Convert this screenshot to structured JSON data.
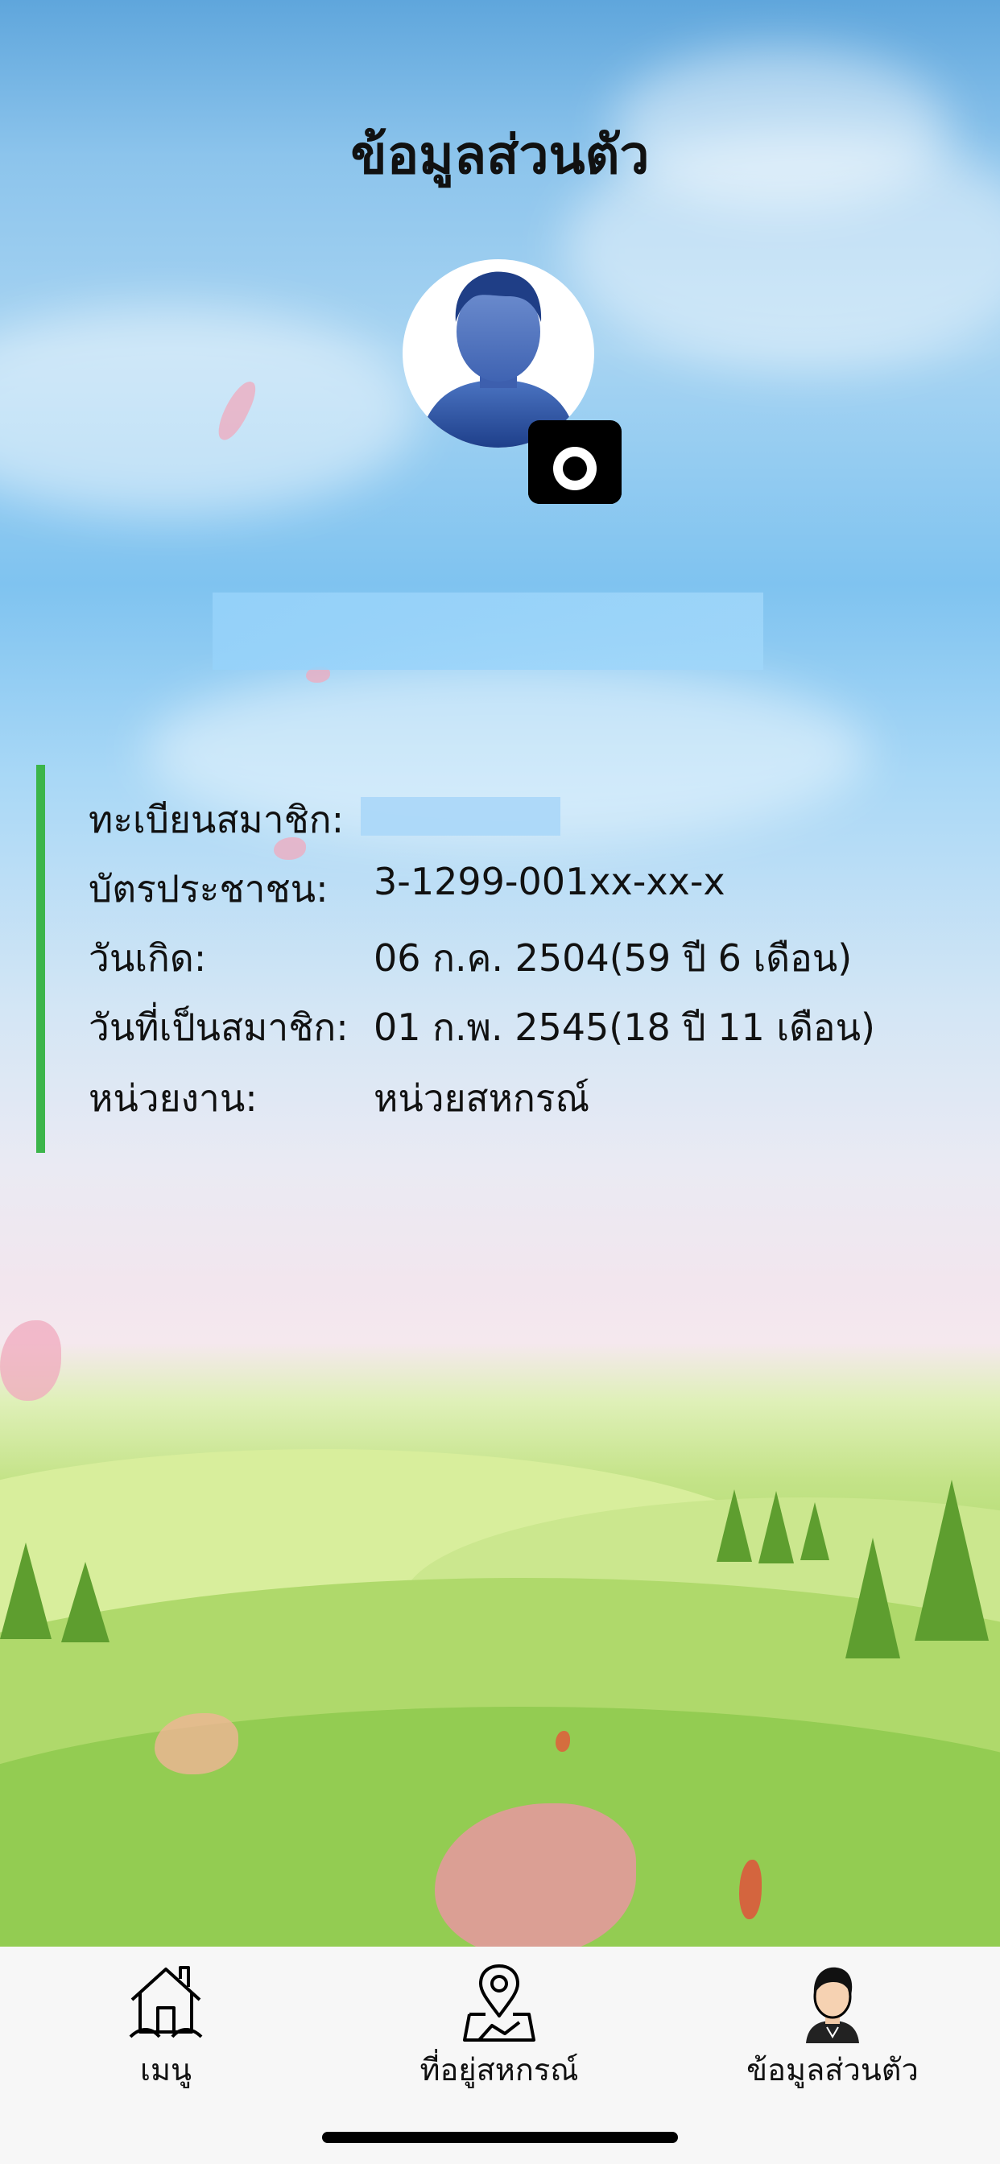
{
  "header": {
    "title": "ข้อมูลส่วนตัว"
  },
  "profile": {
    "avatar_icon": "user-silhouette-icon",
    "camera_icon": "camera-icon"
  },
  "info": {
    "accent_color": "#3cb54a",
    "rows": [
      {
        "label": "ทะเบียนสมาชิก:",
        "value": ""
      },
      {
        "label": "บัตรประชาชน:",
        "value": "3-1299-001xx-xx-x"
      },
      {
        "label": "วันเกิด:",
        "value": "06 ก.ค. 2504(59 ปี 6 เดือน)"
      },
      {
        "label": "วันที่เป็นสมาชิก:",
        "value": "01 ก.พ. 2545(18 ปี 11 เดือน)"
      },
      {
        "label": "หน่วยงาน:",
        "value": "หน่วยสหกรณ์"
      }
    ]
  },
  "nav": {
    "items": [
      {
        "label": "เมนู",
        "icon": "home-icon"
      },
      {
        "label": "ที่อยู่สหกรณ์",
        "icon": "map-pin-icon"
      },
      {
        "label": "ข้อมูลส่วนตัว",
        "icon": "profile-person-icon"
      }
    ]
  }
}
